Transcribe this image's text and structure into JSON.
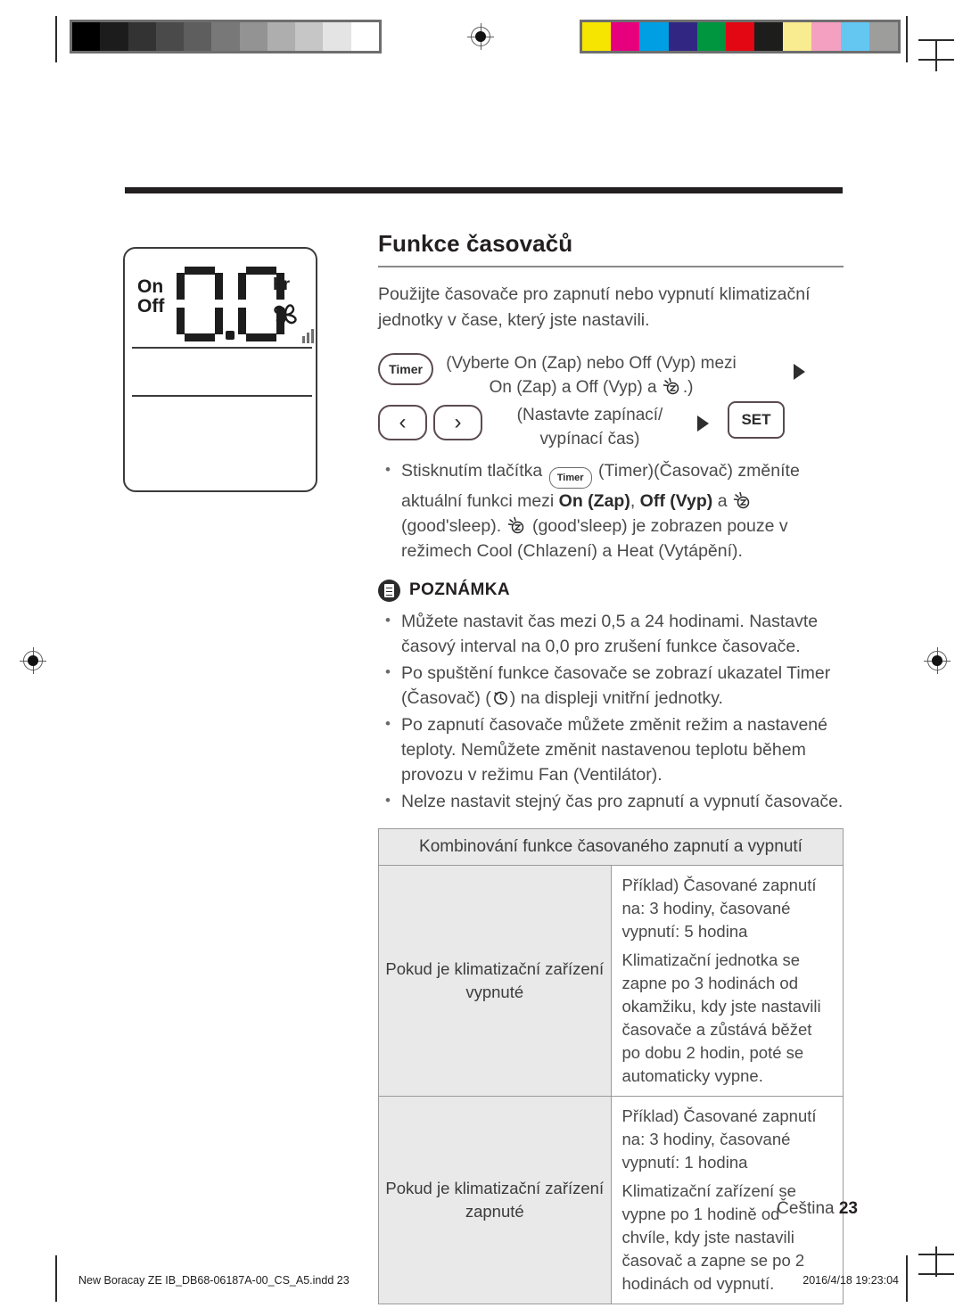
{
  "document": {
    "page_label": "Čeština",
    "page_number": "23",
    "footer_left": "New Boracay ZE IB_DB68-06187A-00_CS_A5.indd   23",
    "footer_right": "2016/4/18   19:23:04"
  },
  "calibration": {
    "grayscale_swatches": [
      "#000000",
      "#1c1c1c",
      "#333333",
      "#4a4a4a",
      "#5e5e5e",
      "#787878",
      "#939393",
      "#aeaeae",
      "#c6c6c6",
      "#e4e4e4",
      "#ffffff"
    ],
    "color_swatches": [
      "#f6e500",
      "#e6007e",
      "#009fe3",
      "#312783",
      "#009640",
      "#e30613",
      "#1d1d1b",
      "#f9eb8f",
      "#f4a0c0",
      "#63c7f2",
      "#9d9d9c"
    ]
  },
  "lcd": {
    "label_on": "On",
    "label_off": "Off",
    "value": "0.0",
    "unit": "hr",
    "fan_icon": "fan-icon",
    "signal_icon": "signal-bars-icon"
  },
  "main": {
    "title": "Funkce časovačů",
    "lead": "Použijte časovače pro zapnutí nebo vypnutí klimatizační jednotky v čase, který jste nastavili.",
    "steps": {
      "timer_button_label": "Timer",
      "prev_button_label": "‹",
      "next_button_label": "›",
      "set_button_label": "SET",
      "step1_line1": "(Vyberte On (Zap) nebo Off (Vyp) mezi",
      "step1_line2_pre": "On (Zap) a Off (Vyp) a ",
      "step1_line2_post": ".)",
      "step2_line1": "(Nastavte zapínací/",
      "step2_line2": "vypínací čas)"
    },
    "intro_bullet": {
      "seg1": "Stisknutím tlačítka ",
      "timer_icon_label": "Timer",
      "seg2": " (Timer)(Časovač) změníte aktuální funkci mezi ",
      "bold1": "On (Zap)",
      "seg3": ", ",
      "bold2": "Off (Vyp)",
      "seg4": " a ",
      "seg5": " (good'sleep). ",
      "seg6": " (good'sleep) je zobrazen pouze v režimech Cool (Chlazení) a Heat (Vytápění)."
    },
    "note": {
      "heading": "POZNÁMKA",
      "icon": "note-document-icon",
      "items": [
        {
          "text": "Můžete nastavit čas mezi 0,5 a 24 hodinami. Nastavte časový interval na 0,0 pro zrušení funkce časovače."
        },
        {
          "pre": "Po spuštění funkce časovače se zobrazí ukazatel Timer (Časovač) (",
          "post": ") na displeji vnitřní jednotky.",
          "icon": "clock-icon"
        },
        {
          "text": "Po zapnutí časovače můžete změnit režim a nastavené teploty. Nemůžete změnit nastavenou teplotu během provozu v režimu Fan (Ventilátor)."
        },
        {
          "text": "Nelze nastavit stejný čas pro zapnutí a vypnutí časovače."
        }
      ]
    },
    "table": {
      "header": "Kombinování funkce časovaného zapnutí a vypnutí",
      "rows": [
        {
          "label": "Pokud je klimatizační zařízení vypnuté",
          "para1": "Příklad) Časované zapnutí na: 3 hodiny, časované vypnutí: 5 hodina",
          "para2": "Klimatizační jednotka se zapne po 3 hodinách od okamžiku, kdy jste nastavili časovače a zůstává běžet po dobu 2 hodin, poté se automaticky vypne."
        },
        {
          "label": "Pokud je klimatizační zařízení zapnuté",
          "para1": "Příklad) Časované zapnutí na: 3 hodiny, časované vypnutí: 1 hodina",
          "para2": "Klimatizační zařízení se vypne po 1 hodině od chvíle, kdy jste nastavili časovač a zapne se po 2 hodinách od vypnutí."
        }
      ]
    }
  }
}
